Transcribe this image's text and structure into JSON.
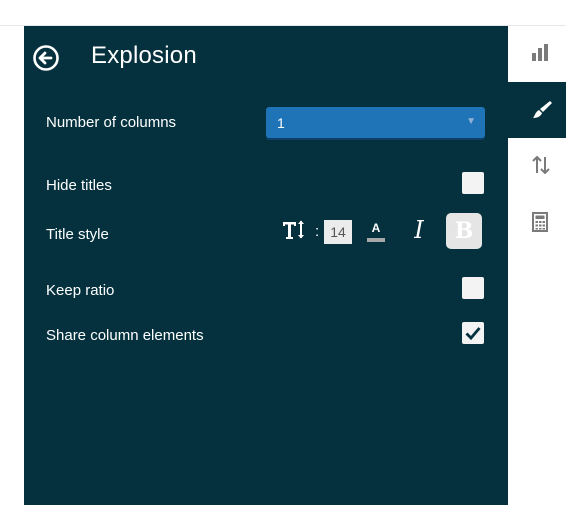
{
  "panel": {
    "title": "Explosion",
    "back_icon": "circle-arrow-left-icon"
  },
  "settings": {
    "columns_label": "Number of columns",
    "columns_value": "1",
    "hide_titles_label": "Hide titles",
    "hide_titles_checked": false,
    "title_style_label": "Title style",
    "title_font_size": "14",
    "font_color_glyph": "A",
    "italic_glyph": "I",
    "bold_glyph": "B",
    "keep_ratio_label": "Keep ratio",
    "keep_ratio_checked": false,
    "share_elements_label": "Share column elements",
    "share_elements_checked": true
  },
  "sidebar": {
    "items": [
      {
        "icon": "bar-chart-icon",
        "active": false
      },
      {
        "icon": "paintbrush-icon",
        "active": true
      },
      {
        "icon": "sort-arrows-icon",
        "active": false
      },
      {
        "icon": "calculator-icon",
        "active": false
      }
    ]
  },
  "colors": {
    "panel_bg": "#04313d",
    "accent_blue": "#1f73b7",
    "icon_gray": "#7a7a7a"
  }
}
